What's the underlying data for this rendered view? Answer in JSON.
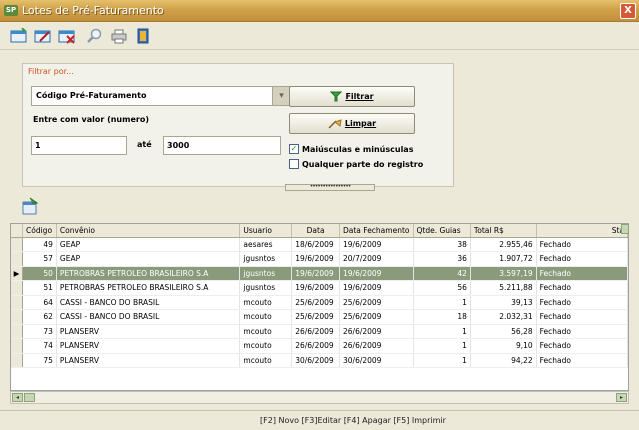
{
  "window": {
    "title": "Lotes de Pré-Faturamento",
    "icon_label": "SP",
    "close_label": "X"
  },
  "toolbar": {
    "buttons": [
      {
        "name": "new-icon",
        "label": ""
      },
      {
        "name": "edit-icon",
        "label": ""
      },
      {
        "name": "delete-icon",
        "label": ""
      },
      {
        "name": "search-icon",
        "label": ""
      },
      {
        "name": "print-icon",
        "label": ""
      },
      {
        "name": "exit-icon",
        "label": ""
      }
    ]
  },
  "filter": {
    "legend": "Filtrar por...",
    "field": "Código Pré-Faturamento",
    "range_label": "Entre com valor (numero)",
    "from_value": "1",
    "to_label": "até",
    "to_value": "3000",
    "filter_button": "Filtrar",
    "clear_button": "Limpar",
    "case_option": "Maiúsculas e minúsculas",
    "case_checked": true,
    "anypart_option": "Qualquer parte do registro",
    "anypart_checked": false
  },
  "grid": {
    "columns": [
      "Código",
      "Convênio",
      "Usuario",
      "Data",
      "Data Fechamento",
      "Qtde. Guias",
      "Total R$",
      "Sta"
    ],
    "rows": [
      {
        "codigo": "49",
        "convenio": "GEAP",
        "usuario": "aesares",
        "data": "18/6/2009",
        "fechamento": "19/6/2009",
        "guias": "38",
        "total": "2.955,46",
        "status": "Fechado"
      },
      {
        "codigo": "57",
        "convenio": "GEAP",
        "usuario": "jgusntos",
        "data": "19/6/2009",
        "fechamento": "20/7/2009",
        "guias": "36",
        "total": "1.907,72",
        "status": "Fechado"
      },
      {
        "codigo": "50",
        "convenio": "PETROBRAS PETROLEO BRASILEIRO S.A",
        "usuario": "jgusntos",
        "data": "19/6/2009",
        "fechamento": "19/6/2009",
        "guias": "42",
        "total": "3.597,19",
        "status": "Fechado",
        "selected": true
      },
      {
        "codigo": "51",
        "convenio": "PETROBRAS PETROLEO BRASILEIRO S.A",
        "usuario": "jgusntos",
        "data": "19/6/2009",
        "fechamento": "19/6/2009",
        "guias": "56",
        "total": "5.211,88",
        "status": "Fechado"
      },
      {
        "codigo": "64",
        "convenio": "CASSI - BANCO DO BRASIL",
        "usuario": "mcouto",
        "data": "25/6/2009",
        "fechamento": "25/6/2009",
        "guias": "1",
        "total": "39,13",
        "status": "Fechado"
      },
      {
        "codigo": "62",
        "convenio": "CASSI - BANCO DO BRASIL",
        "usuario": "mcouto",
        "data": "25/6/2009",
        "fechamento": "25/6/2009",
        "guias": "18",
        "total": "2.032,31",
        "status": "Fechado"
      },
      {
        "codigo": "73",
        "convenio": "PLANSERV",
        "usuario": "mcouto",
        "data": "26/6/2009",
        "fechamento": "26/6/2009",
        "guias": "1",
        "total": "56,28",
        "status": "Fechado"
      },
      {
        "codigo": "74",
        "convenio": "PLANSERV",
        "usuario": "mcouto",
        "data": "26/6/2009",
        "fechamento": "26/6/2009",
        "guias": "1",
        "total": "9,10",
        "status": "Fechado"
      },
      {
        "codigo": "75",
        "convenio": "PLANSERV",
        "usuario": "mcouto",
        "data": "30/6/2009",
        "fechamento": "30/6/2009",
        "guias": "1",
        "total": "94,22",
        "status": "Fechado"
      }
    ]
  },
  "status_bar": {
    "text": "[F2] Novo [F3]Editar [F4] Apagar [F5] Imprimir"
  },
  "colors": {
    "title_bar": "#d0a14a",
    "selection": "#8a9b7c",
    "legend": "#d0541a"
  }
}
